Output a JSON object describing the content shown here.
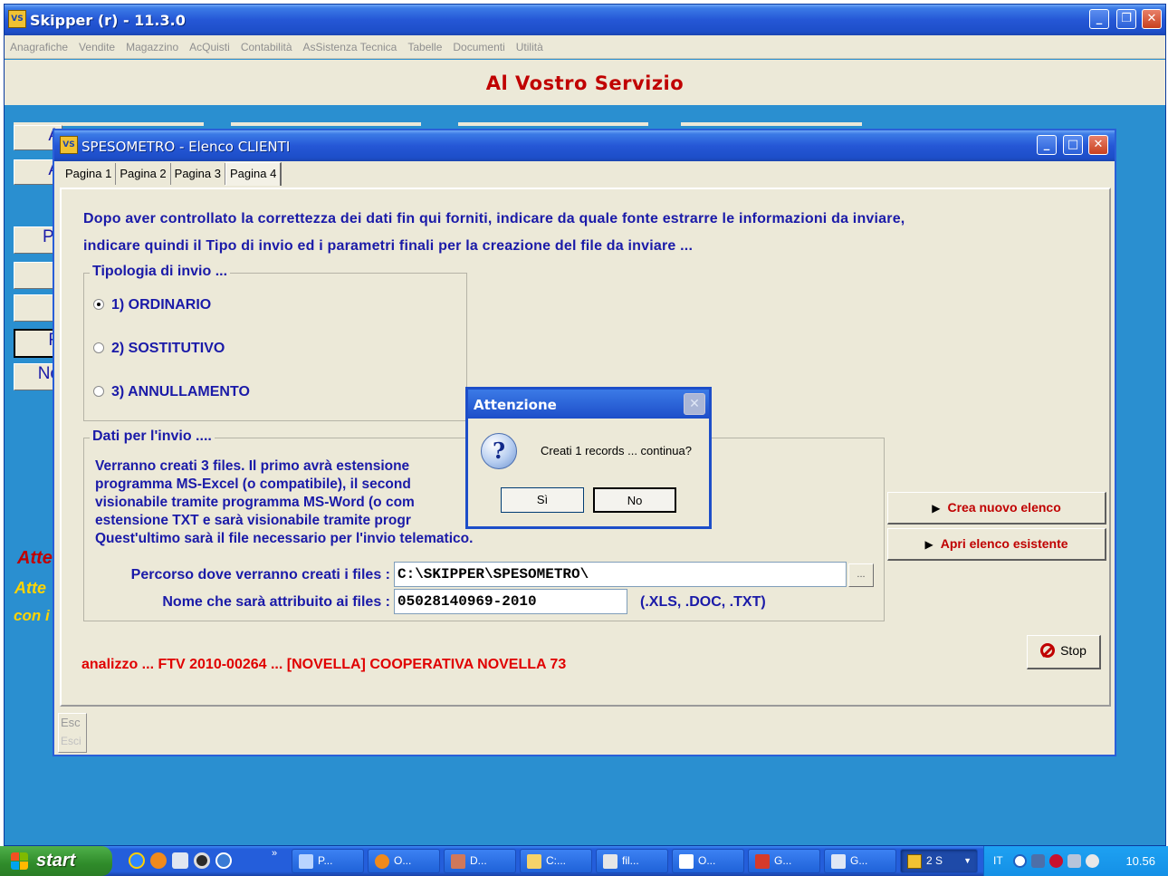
{
  "main_window": {
    "title": "Skipper (r) - 11.3.0",
    "menu": [
      "Anagrafiche",
      "Vendite",
      "Magazzino",
      "AcQuisti",
      "Contabilità",
      "AsSistenza Tecnica",
      "Tabelle",
      "Documenti",
      "Utilità"
    ],
    "banner": "Al Vostro Servizio",
    "background_buttons": [
      "A",
      "A",
      "Pr",
      "F",
      "No"
    ],
    "background_italic_text": "Atte",
    "background_yellow_1": "Atte",
    "background_yellow_2": "con i"
  },
  "child_window": {
    "title": "SPESOMETRO - Elenco CLIENTI",
    "tabs": [
      "Pagina 1",
      "Pagina 2",
      "Pagina 3",
      "Pagina 4"
    ],
    "active_tab": "Pagina 4",
    "intro_line_1": "Dopo aver controllato la correttezza dei dati fin qui forniti, indicare da quale fonte estrarre le informazioni da inviare,",
    "intro_line_2": "indicare quindi il Tipo di invio ed i parametri finali per la creazione del file da inviare ...",
    "tipologia": {
      "legend": "Tipologia di invio ...",
      "options": [
        "1) ORDINARIO",
        "2) SOSTITUTIVO",
        "3) ANNULLAMENTO"
      ],
      "selected": "1) ORDINARIO"
    },
    "dati": {
      "legend": "Dati per l'invio ....",
      "lines": [
        "Verranno creati 3 files. Il primo avrà estensione",
        "programma MS-Excel (o compatibile), il second",
        "visionabile tramite programma MS-Word (o com",
        "estensione TXT e sarà visionabile tramite progr",
        "Quest'ultimo sarà  il file necessario per l'invio telematico."
      ],
      "path_label": "Percorso dove verranno creati i files :",
      "path_value": "C:\\SKIPPER\\SPESOMETRO\\",
      "browse_label": "...",
      "name_label": "Nome che sarà attribuito ai files :",
      "name_value": "05028140969-2010",
      "extensions": "(.XLS, .DOC, .TXT)"
    },
    "buttons": {
      "crea": "Crea nuovo elenco",
      "apri": "Apri elenco esistente",
      "stop": "Stop"
    },
    "status": "analizzo ... FTV 2010-00264 ... [NOVELLA] COOPERATIVA NOVELLA 73",
    "esc": {
      "label": "Esc",
      "sub": "Esci"
    }
  },
  "dialog": {
    "title": "Attenzione",
    "message": "Creati 1 records ... continua?",
    "yes": "Sì",
    "no": "No"
  },
  "taskbar": {
    "start": "start",
    "items": [
      "P...",
      "O...",
      "D...",
      "C:...",
      "fil...",
      "O...",
      "G...",
      "G...",
      "2 S"
    ],
    "language": "IT",
    "clock": "10.56"
  }
}
